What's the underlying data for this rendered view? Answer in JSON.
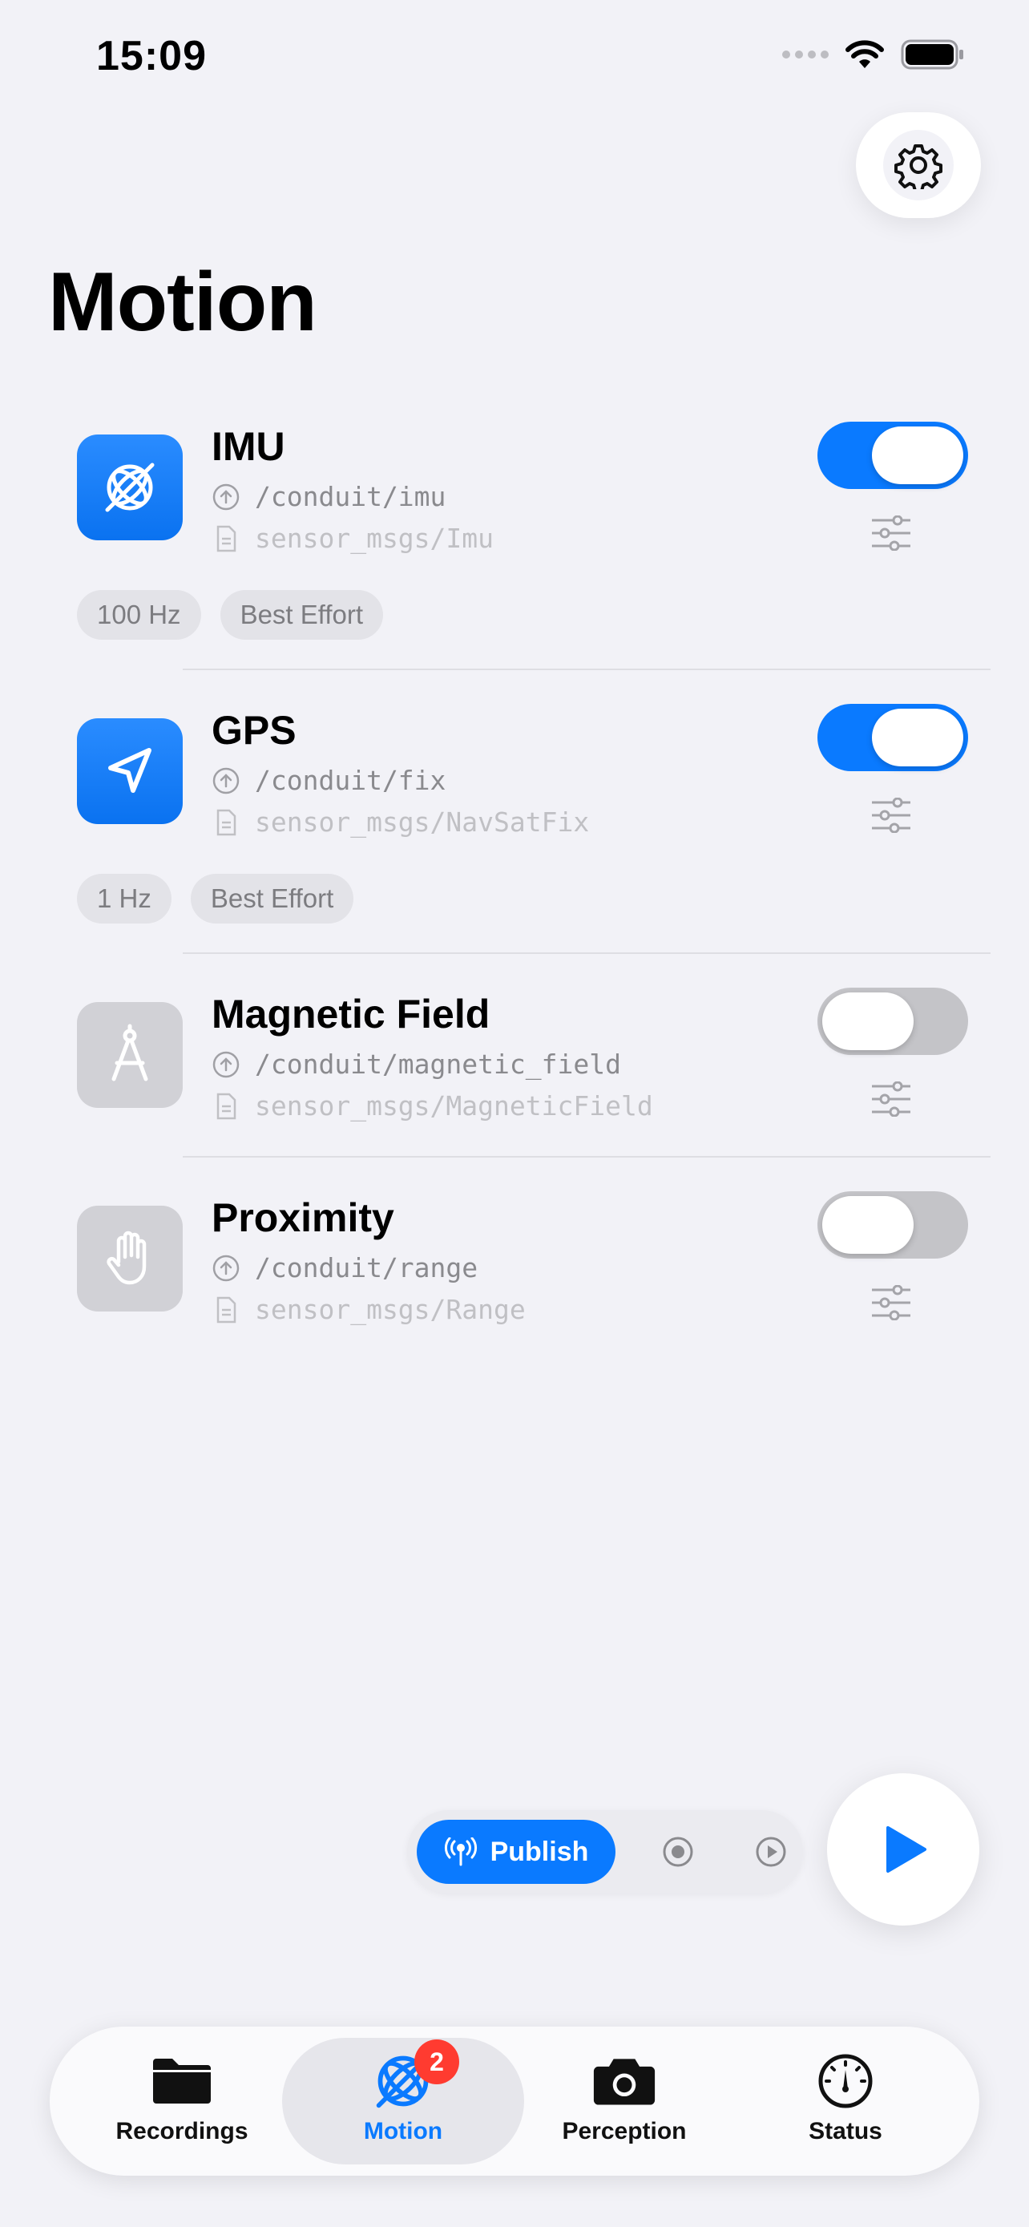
{
  "status_bar": {
    "time": "15:09"
  },
  "page": {
    "title": "Motion"
  },
  "sensors": [
    {
      "name": "IMU",
      "topic": "/conduit/imu",
      "type": "sensor_msgs/Imu",
      "enabled": true,
      "icon": "gyroscope-icon",
      "chips": [
        "100 Hz",
        "Best Effort"
      ]
    },
    {
      "name": "GPS",
      "topic": "/conduit/fix",
      "type": "sensor_msgs/NavSatFix",
      "enabled": true,
      "icon": "location-arrow-icon",
      "chips": [
        "1 Hz",
        "Best Effort"
      ]
    },
    {
      "name": "Magnetic Field",
      "topic": "/conduit/magnetic_field",
      "type": "sensor_msgs/MagneticField",
      "enabled": false,
      "icon": "compass-drafting-icon",
      "chips": []
    },
    {
      "name": "Proximity",
      "topic": "/conduit/range",
      "type": "sensor_msgs/Range",
      "enabled": false,
      "icon": "hand-icon",
      "chips": []
    }
  ],
  "mode_bar": {
    "selected_label": "Publish"
  },
  "tabs": [
    {
      "label": "Recordings",
      "icon": "folder-icon"
    },
    {
      "label": "Motion",
      "icon": "gyroscope-icon",
      "badge": "2",
      "selected": true
    },
    {
      "label": "Perception",
      "icon": "camera-icon"
    },
    {
      "label": "Status",
      "icon": "gauge-icon"
    }
  ],
  "colors": {
    "accent": "#0A7AFF",
    "background": "#F2F2F7",
    "badge": "#FF3B30"
  }
}
